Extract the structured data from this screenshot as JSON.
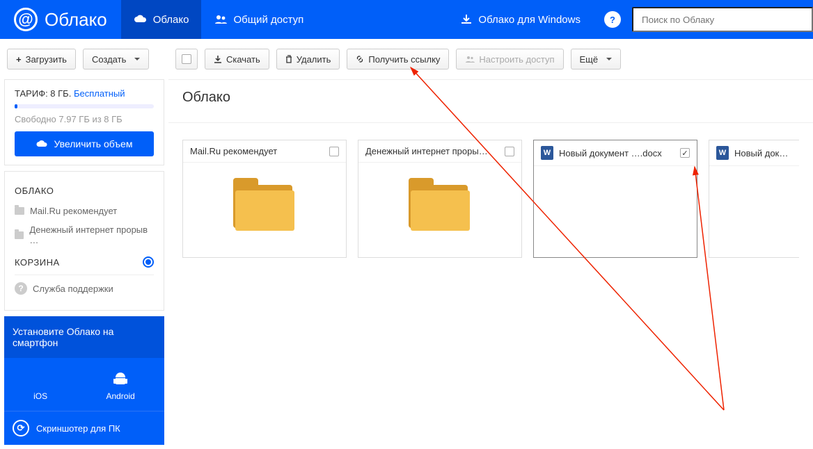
{
  "brand": "Облако",
  "nav": {
    "cloud": "Облако",
    "shared": "Общий доступ",
    "windows": "Облако для Windows"
  },
  "search_placeholder": "Поиск по Облаку",
  "sidebar_buttons": {
    "upload": "Загрузить",
    "create": "Создать"
  },
  "toolbar": {
    "download": "Скачать",
    "delete": "Удалить",
    "get_link": "Получить ссылку",
    "share": "Настроить доступ",
    "more": "Ещё"
  },
  "tariff": {
    "label": "ТАРИФ: 8 ГБ.",
    "plan": "Бесплатный",
    "free_text": "Свободно 7.97 ГБ из 8 ГБ",
    "upgrade": "Увеличить объем"
  },
  "side": {
    "cloud_head": "ОБЛАКО",
    "item1": "Mail.Ru рекомендует",
    "item2": "Денежный интернет прорыв …",
    "trash_head": "КОРЗИНА",
    "support": "Служба поддержки"
  },
  "promo": {
    "title": "Установите Облако на смартфон",
    "ios": "iOS",
    "android": "Android",
    "screenshoter": "Скриншотер для ПК"
  },
  "breadcrumb": "Облако",
  "files": [
    {
      "name": "Mail.Ru рекомендует",
      "type": "folder",
      "checked": false
    },
    {
      "name": "Денежный интернет проры…",
      "type": "folder",
      "checked": false
    },
    {
      "name": "Новый документ ….docx",
      "type": "doc",
      "checked": true
    },
    {
      "name": "Новый докумен",
      "type": "doc",
      "checked": false
    }
  ]
}
